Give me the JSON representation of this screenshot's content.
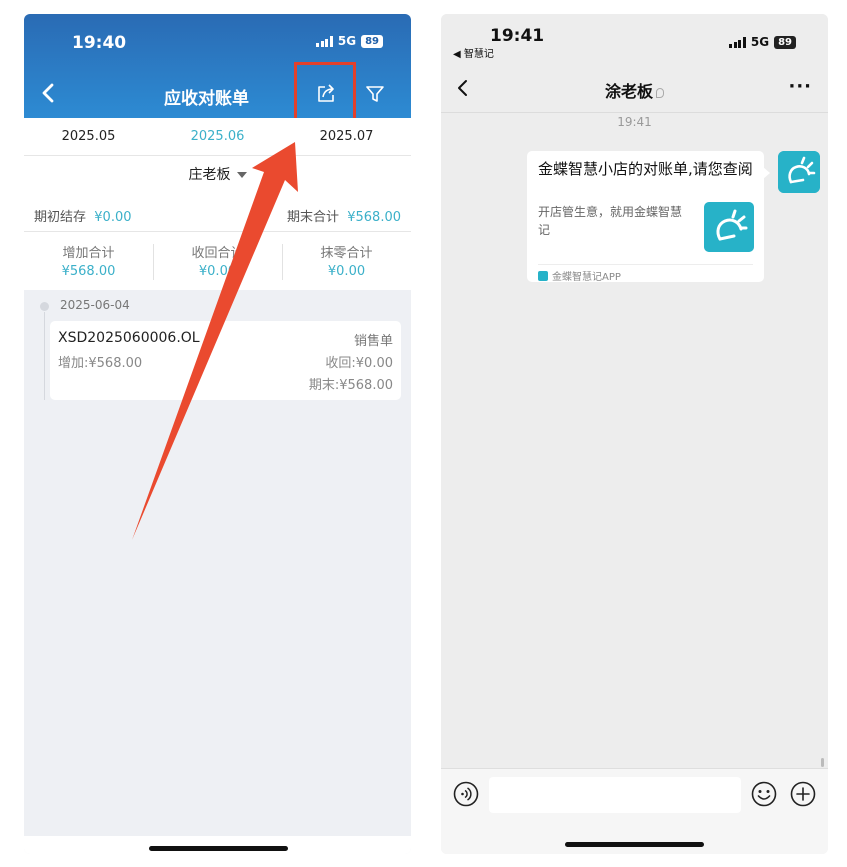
{
  "left": {
    "status": {
      "time": "19:40",
      "network": "5G",
      "battery": "89"
    },
    "nav": {
      "title": "应收对账单"
    },
    "months": [
      "2025.05",
      "2025.06",
      "2025.07"
    ],
    "client": "庄老板",
    "balance": {
      "opening_label": "期初结存",
      "opening_value": "¥0.00",
      "closing_label": "期末合计",
      "closing_value": "¥568.00"
    },
    "totals": [
      {
        "label": "增加合计",
        "value": "¥568.00"
      },
      {
        "label": "收回合计",
        "value": "¥0.00"
      },
      {
        "label": "抹零合计",
        "value": "¥0.00"
      }
    ],
    "entry": {
      "date": "2025-06-04",
      "number": "XSD2025060006.OL",
      "type": "销售单",
      "add": "增加:¥568.00",
      "received": "收回:¥0.00",
      "closing": "期末:¥568.00"
    },
    "colors": {
      "header": "#2d7fc9",
      "accent": "#3bb0c9",
      "highlight": "#e3402b"
    }
  },
  "right": {
    "status": {
      "time": "19:41",
      "back_app": "◀ 智慧记",
      "network": "5G",
      "battery": "89"
    },
    "chat": {
      "title": "涂老板",
      "timestamp": "19:41"
    },
    "message": {
      "title": "金蝶智慧小店的对账单,请您查阅",
      "description": "开店管生意，就用金蝶智慧记",
      "source": "金蝶智慧记APP"
    },
    "colors": {
      "app": "#27b2c8"
    }
  }
}
